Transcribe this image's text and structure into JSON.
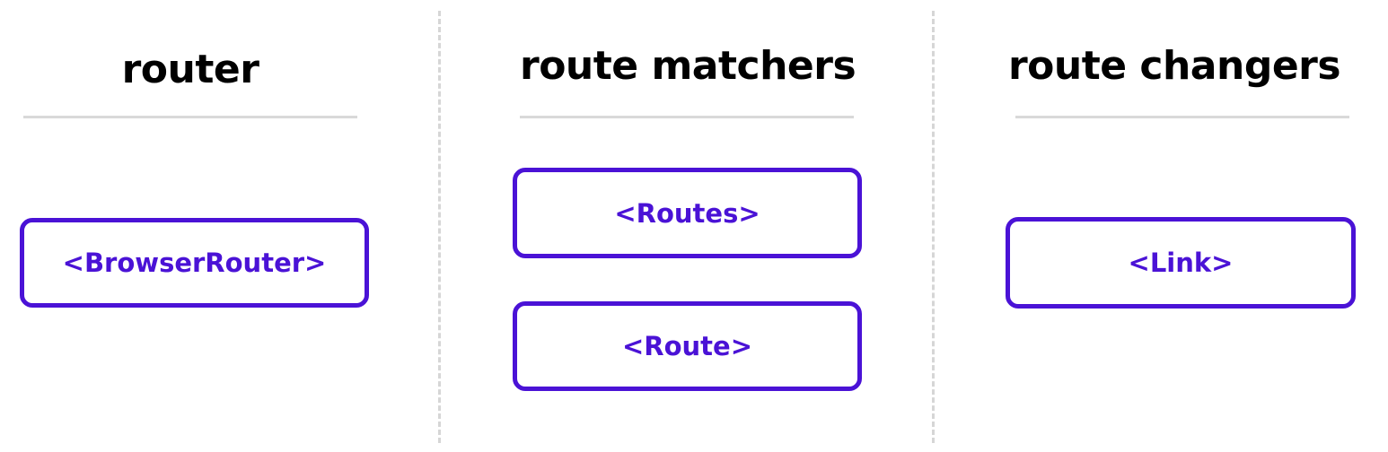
{
  "colors": {
    "accent": "#4a12d6",
    "heading": "#000000",
    "rule": "#d9d9d9",
    "divider": "#d6d6d6"
  },
  "columns": [
    {
      "title": "router",
      "items": [
        "<BrowserRouter>"
      ]
    },
    {
      "title": "route matchers",
      "items": [
        "<Routes>",
        "<Route>"
      ]
    },
    {
      "title": "route changers",
      "items": [
        "<Link>"
      ]
    }
  ]
}
